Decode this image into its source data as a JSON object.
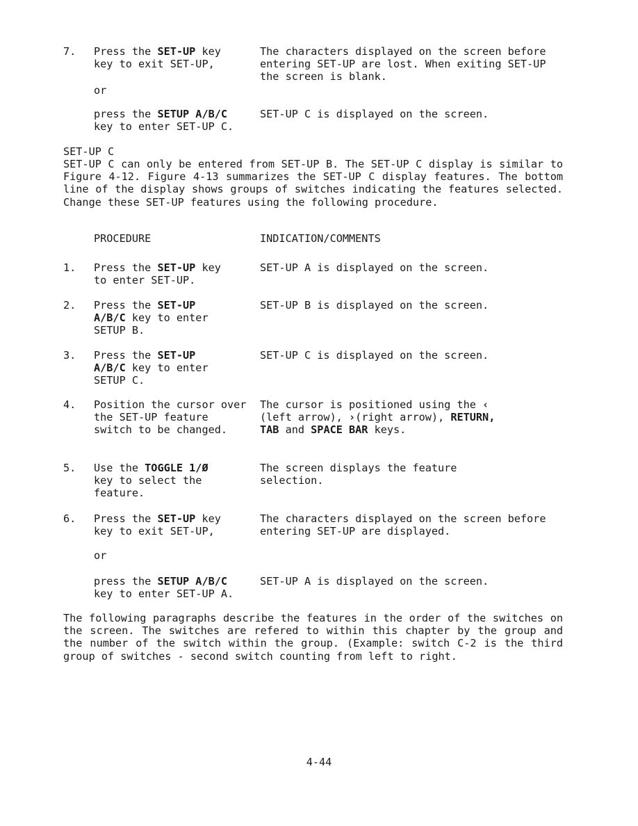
{
  "step7_prev": {
    "number": "7.",
    "left_a": "Press the ",
    "left_a_bold": "SET-UP",
    "left_a_end": " key",
    "left_b": "key to exit SET-UP,",
    "right": "The characters displayed on the screen before entering SET-UP are lost. When exiting SET-UP the screen is blank.",
    "or": "or",
    "alt_left_a": "press the ",
    "alt_left_a_bold": "SETUP A/B/C",
    "alt_left_b": "key to enter SET-UP C.",
    "alt_right": "SET-UP C is displayed on the screen."
  },
  "section": {
    "heading": "SET-UP C",
    "paragraph": "SET-UP C can only be entered from SET-UP B. The SET-UP C display is similar to Figure 4-12. Figure 4-13 summarizes the SET-UP C display features. The bottom line of the display shows groups of switches indicating the features selected. Change these SET-UP features using the following procedure."
  },
  "columns": {
    "procedure": "PROCEDURE",
    "indication": "INDICATION/COMMENTS"
  },
  "steps": [
    {
      "number": "1.",
      "left_pre": "Press the ",
      "left_bold": "SET-UP",
      "left_post": " key",
      "left_rest": "to enter SET-UP.",
      "right": "SET-UP A is displayed on the screen."
    },
    {
      "number": "2.",
      "left_pre": "Press the ",
      "left_bold": "SET-UP",
      "left_bold2": "A/B/C",
      "left_post2": " key to enter",
      "left_rest": "SETUP B.",
      "right": "SET-UP B is displayed on the screen."
    },
    {
      "number": "3.",
      "left_pre": "Press the ",
      "left_bold": "SET-UP",
      "left_bold2": "A/B/C",
      "left_post2": " key to enter",
      "left_rest": "SETUP C.",
      "right": "SET-UP C is displayed on the screen."
    },
    {
      "number": "4.",
      "left": "Position the cursor over the SET-UP feature switch to be changed.",
      "right_a": "The cursor is positioned using the ",
      "left_arrow": "‹",
      "right_b": "(left arrow), ",
      "right_arrow": "›",
      "right_c": "(right arrow), ",
      "right_bold1": "RETURN,",
      "right_bold2": "TAB",
      "right_d": " and ",
      "right_bold3": "SPACE BAR",
      "right_e": " keys."
    },
    {
      "number": "5.",
      "left_pre": "Use the ",
      "left_bold": "TOGGLE 1/Ø",
      "left_rest": "key to select the feature.",
      "right": "The screen displays the feature selection."
    },
    {
      "number": "6.",
      "left_pre": "Press the ",
      "left_bold": "SET-UP",
      "left_post": " key",
      "left_rest": "key to exit SET-UP,",
      "right": "The characters displayed on the screen before entering SET-UP are displayed.",
      "or": "or",
      "alt_left_pre": "press the ",
      "alt_left_bold": "SETUP A/B/C",
      "alt_left_rest": "key to enter SET-UP A.",
      "alt_right": "SET-UP A is displayed on the screen."
    }
  ],
  "closing_paragraph": "The following paragraphs describe the features in the order of the switches on the screen. The switches are refered to within this chapter by the group and the number of the switch within the group. (Example: switch C-2 is the third group of switches - second switch counting from left to right.",
  "footer": {
    "page_number": "4-44"
  }
}
